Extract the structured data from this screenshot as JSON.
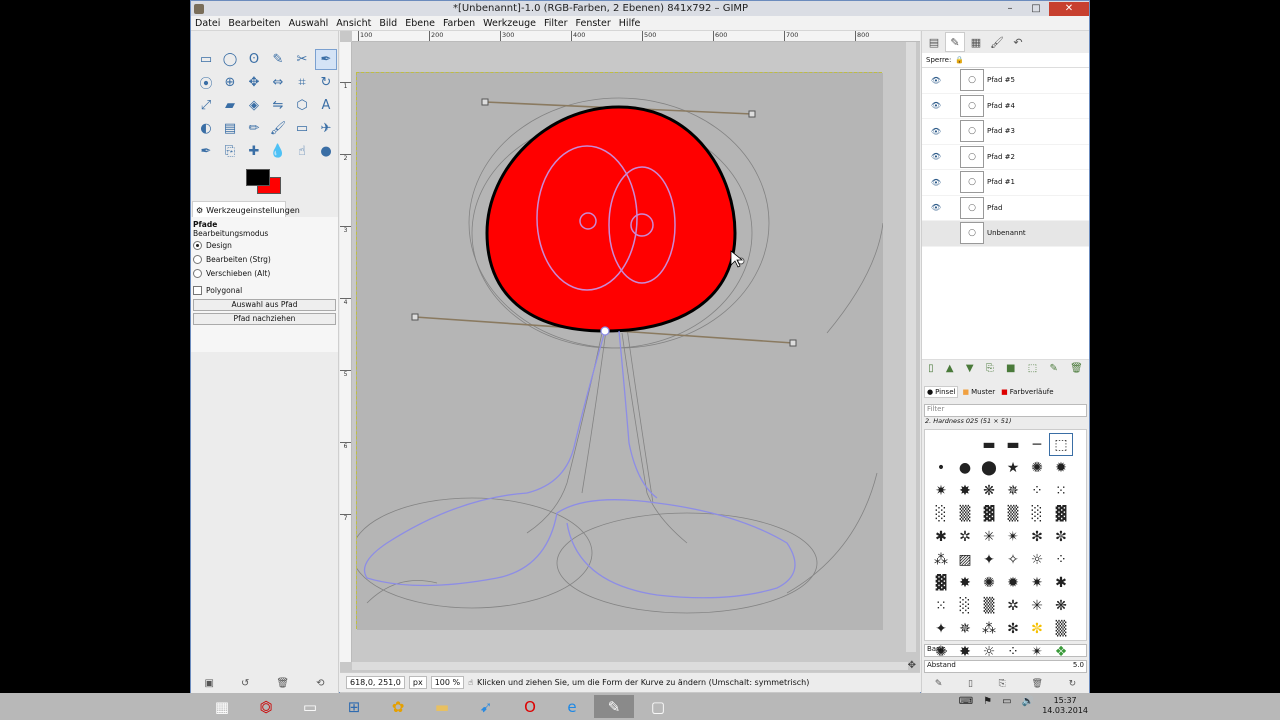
{
  "window": {
    "title": "*[Unbenannt]-1.0 (RGB-Farben, 2 Ebenen) 841x792 – GIMP",
    "minimize": "–",
    "maximize": "□",
    "close": "✕"
  },
  "menu": [
    "Datei",
    "Bearbeiten",
    "Auswahl",
    "Ansicht",
    "Bild",
    "Ebene",
    "Farben",
    "Werkzeuge",
    "Filter",
    "Fenster",
    "Hilfe"
  ],
  "tools": [
    {
      "name": "rect-select-icon",
      "glyph": "▭"
    },
    {
      "name": "ellipse-select-icon",
      "glyph": "◯"
    },
    {
      "name": "free-select-icon",
      "glyph": "ʘ"
    },
    {
      "name": "fuzzy-select-icon",
      "glyph": "✎"
    },
    {
      "name": "scissors-icon",
      "glyph": "✂"
    },
    {
      "name": "paths-tool-icon",
      "glyph": "✒"
    },
    {
      "name": "color-picker-icon",
      "glyph": "⦿"
    },
    {
      "name": "zoom-icon",
      "glyph": "⊕"
    },
    {
      "name": "move-icon",
      "glyph": "✥"
    },
    {
      "name": "align-icon",
      "glyph": "⇔"
    },
    {
      "name": "crop-icon",
      "glyph": "⌗"
    },
    {
      "name": "rotate-icon",
      "glyph": "↻"
    },
    {
      "name": "scale-icon",
      "glyph": "⤢"
    },
    {
      "name": "shear-icon",
      "glyph": "▰"
    },
    {
      "name": "perspective-icon",
      "glyph": "◈"
    },
    {
      "name": "flip-icon",
      "glyph": "⇋"
    },
    {
      "name": "cage-icon",
      "glyph": "⬡"
    },
    {
      "name": "text-icon",
      "glyph": "A"
    },
    {
      "name": "bucket-fill-icon",
      "glyph": "◐"
    },
    {
      "name": "blend-icon",
      "glyph": "▤"
    },
    {
      "name": "pencil-icon",
      "glyph": "✏"
    },
    {
      "name": "paintbrush-icon",
      "glyph": "🖌"
    },
    {
      "name": "eraser-icon",
      "glyph": "▭"
    },
    {
      "name": "airbrush-icon",
      "glyph": "✈"
    },
    {
      "name": "ink-icon",
      "glyph": "✒"
    },
    {
      "name": "clone-icon",
      "glyph": "⎘"
    },
    {
      "name": "heal-icon",
      "glyph": "✚"
    },
    {
      "name": "blur-icon",
      "glyph": "💧"
    },
    {
      "name": "smudge-icon",
      "glyph": "☝"
    },
    {
      "name": "dodge-icon",
      "glyph": "●"
    }
  ],
  "tool_options": {
    "tab_label": "Werkzeugeinstellungen",
    "section": "Pfade",
    "mode_label": "Bearbeitungsmodus",
    "modes": [
      "Design",
      "Bearbeiten (Strg)",
      "Verschieben (Alt)"
    ],
    "selected_mode": "Design",
    "polygonal": "Polygonal",
    "btn_selection": "Auswahl aus Pfad",
    "btn_stroke": "Pfad nachziehen"
  },
  "ruler": {
    "h": [
      "100",
      "200",
      "300",
      "400",
      "500",
      "600",
      "700",
      "800"
    ],
    "v": [
      "1",
      "2",
      "3",
      "4",
      "5",
      "6",
      "7"
    ]
  },
  "status": {
    "coords": "618,0, 251,0",
    "unit": "px",
    "zoom": "100 %",
    "message": "Klicken und ziehen Sie, um die Form der Kurve zu ändern (Umschalt: symmetrisch)"
  },
  "dock": {
    "lock_label": "Sperre:",
    "layers": [
      {
        "name": "Pfad #5",
        "visible": true
      },
      {
        "name": "Pfad #4",
        "visible": true
      },
      {
        "name": "Pfad #3",
        "visible": true
      },
      {
        "name": "Pfad #2",
        "visible": true
      },
      {
        "name": "Pfad #1",
        "visible": true
      },
      {
        "name": "Pfad",
        "visible": true
      },
      {
        "name": "Unbenannt",
        "visible": false
      }
    ],
    "brush_tabs": [
      "Pinsel",
      "Muster",
      "Farbverläufe"
    ],
    "filter_placeholder": "Filter",
    "brush_name": "2. Hardness 025 (51 × 51)",
    "preset": "Basic,",
    "spacing_label": "Abstand",
    "spacing_value": "5.0"
  },
  "clock": {
    "time": "15:37",
    "date": "14.03.2014"
  },
  "colors": {
    "fg": "#000000",
    "bg": "#ff0000",
    "accent": "#3a6ea5"
  }
}
